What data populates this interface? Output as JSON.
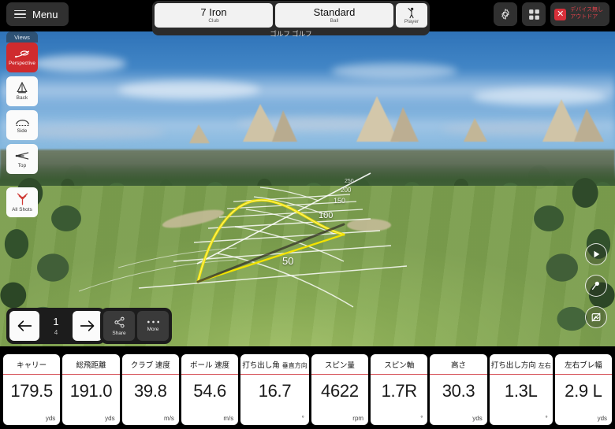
{
  "topbar": {
    "menu_label": "Menu",
    "menu_icon": "hamburger-icon",
    "club": {
      "value": "7 Iron",
      "label": "Club"
    },
    "ball": {
      "value": "Standard",
      "label": "Ball"
    },
    "player": {
      "label": "Player",
      "icon": "golfer-icon"
    },
    "caption": "ゴルフ ゴルフ",
    "settings_icon": "gear-icon",
    "apps_icon": "grid-icon",
    "device_badge": {
      "icon": "x-icon",
      "line1": "デバイス無し",
      "line2": "アウトドア",
      "color": "#e0434c"
    }
  },
  "views": {
    "title": "Views",
    "items": [
      {
        "label": "Perspective",
        "icon": "perspective-icon",
        "active": true
      },
      {
        "label": "Back",
        "icon": "back-view-icon",
        "active": false
      },
      {
        "label": "Side",
        "icon": "side-view-icon",
        "active": false
      },
      {
        "label": "Top",
        "icon": "top-view-icon",
        "active": false
      },
      {
        "label": "All Shots",
        "icon": "dispersion-icon",
        "active": false
      }
    ],
    "active_color": "#cf2b2e"
  },
  "shot_nav": {
    "prev_icon": "arrow-left-icon",
    "next_icon": "arrow-right-icon",
    "current": "1",
    "total": "4"
  },
  "actions": [
    {
      "label": "Share",
      "icon": "share-icon"
    },
    {
      "label": "More",
      "icon": "ellipsis-icon"
    }
  ],
  "round_buttons": [
    {
      "icon": "play-icon"
    },
    {
      "icon": "tee-pin-icon"
    },
    {
      "icon": "capture-icon"
    }
  ],
  "range": {
    "distance_markers": [
      "50",
      "100",
      "150",
      "200",
      "250"
    ],
    "trajectory_color": "#f2e200"
  },
  "stats": [
    {
      "title": "キャリー",
      "sub": "",
      "value": "179.5",
      "unit": "yds"
    },
    {
      "title": "総飛距離",
      "sub": "",
      "value": "191.0",
      "unit": "yds"
    },
    {
      "title": "クラブ 速度",
      "sub": "",
      "value": "39.8",
      "unit": "m/s"
    },
    {
      "title": "ボール 速度",
      "sub": "",
      "value": "54.6",
      "unit": "m/s"
    },
    {
      "title": "打ち出し角",
      "sub": "垂直方向",
      "value": "16.7",
      "unit": "°"
    },
    {
      "title": "スピン量",
      "sub": "",
      "value": "4622",
      "unit": "rpm"
    },
    {
      "title": "スピン軸",
      "sub": "",
      "value": "1.7R",
      "unit": "°"
    },
    {
      "title": "高さ",
      "sub": "",
      "value": "30.3",
      "unit": "yds"
    },
    {
      "title": "打ち出し方向",
      "sub": "左右",
      "value": "1.3L",
      "unit": "°"
    },
    {
      "title": "左右ブレ幅",
      "sub": "",
      "value": "2.9 L",
      "unit": "yds"
    }
  ]
}
